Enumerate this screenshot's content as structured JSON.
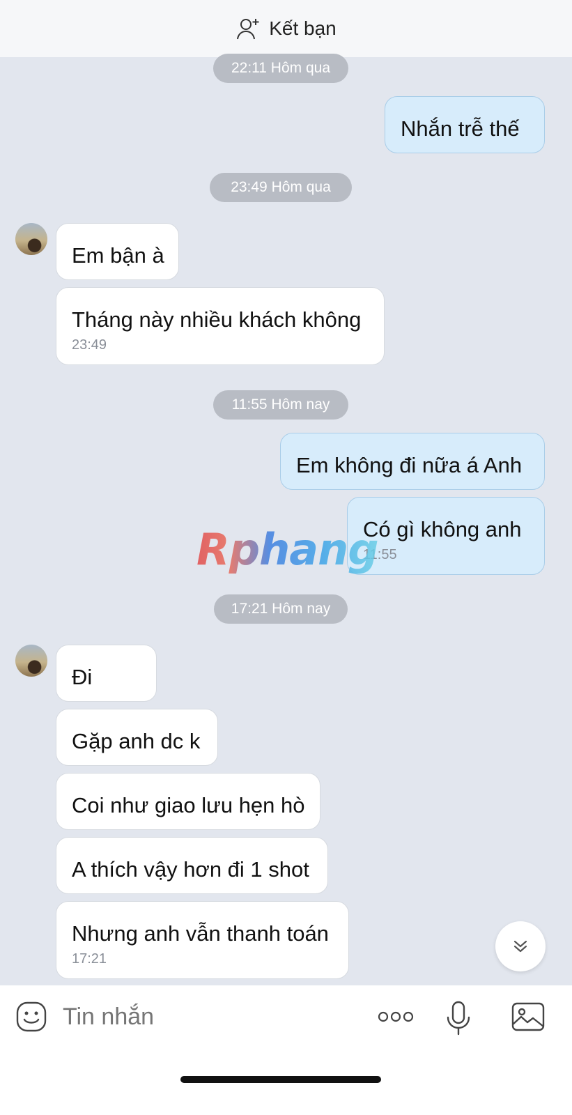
{
  "header": {
    "add_friend_label": "Kết bạn"
  },
  "timestamps": [
    "22:11 Hôm qua",
    "23:49 Hôm qua",
    "11:55 Hôm nay",
    "17:21 Hôm nay"
  ],
  "messages": [
    {
      "text": "Nhắn trễ thế",
      "direction": "outgoing"
    },
    {
      "text": "Em bận à",
      "direction": "incoming"
    },
    {
      "text": "Tháng này nhiều khách không",
      "direction": "incoming",
      "time": "23:49"
    },
    {
      "text": "Em không đi nữa á Anh",
      "direction": "outgoing"
    },
    {
      "text": "Có gì không anh",
      "direction": "outgoing",
      "time": "11:55"
    },
    {
      "text": "Đi",
      "direction": "incoming"
    },
    {
      "text": "Gặp anh dc k",
      "direction": "incoming"
    },
    {
      "text": "Coi như giao lưu hẹn hò",
      "direction": "incoming"
    },
    {
      "text": "A thích vậy hơn đi 1 shot",
      "direction": "incoming"
    },
    {
      "text": "Nhưng anh vẫn thanh toán",
      "direction": "incoming",
      "time": "17:21"
    }
  ],
  "watermark": "Rphang",
  "composer": {
    "placeholder": "Tin nhắn"
  },
  "icons": {
    "add_friend": "add-user-icon",
    "scroll_down": "chevron-double-down-icon",
    "emoji": "emoji-icon",
    "more": "more-dots-icon",
    "mic": "microphone-icon",
    "image": "image-icon"
  },
  "colors": {
    "incoming_bubble": "#ffffff",
    "outgoing_bubble": "#d7ecfb",
    "background": "#e2e6ee",
    "timestamp_pill": "#b8bcc4"
  }
}
